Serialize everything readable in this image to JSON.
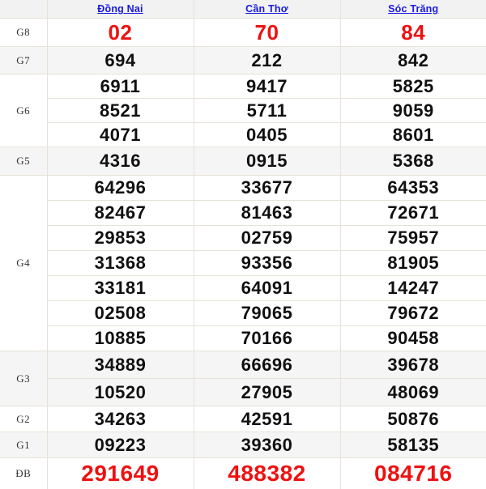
{
  "table": {
    "header": {
      "label_blank": "",
      "provinces": [
        {
          "name": "Đồng Nai"
        },
        {
          "name": "Cần Thơ"
        },
        {
          "name": "Sóc Trăng"
        }
      ]
    },
    "link_color": "#1a1ae0",
    "highlight_color": "#ee1111",
    "text_color": "#101010",
    "row_shade_color": "#f5f5f5",
    "border_color": "#e6e2d8",
    "prizes": [
      {
        "label": "G8",
        "style": "red",
        "rows": [
          {
            "values": [
              "02",
              "70",
              "84"
            ]
          }
        ]
      },
      {
        "label": "G7",
        "style": "normal",
        "rows": [
          {
            "values": [
              "694",
              "212",
              "842"
            ]
          }
        ]
      },
      {
        "label": "G6",
        "style": "normal",
        "rows": [
          {
            "values": [
              "6911",
              "9417",
              "5825"
            ]
          },
          {
            "values": [
              "8521",
              "5711",
              "9059"
            ]
          },
          {
            "values": [
              "4071",
              "0405",
              "8601"
            ]
          }
        ]
      },
      {
        "label": "G5",
        "style": "normal",
        "rows": [
          {
            "values": [
              "4316",
              "0915",
              "5368"
            ]
          }
        ]
      },
      {
        "label": "G4",
        "style": "normal",
        "rows": [
          {
            "values": [
              "64296",
              "33677",
              "64353"
            ]
          },
          {
            "values": [
              "82467",
              "81463",
              "72671"
            ]
          },
          {
            "values": [
              "29853",
              "02759",
              "75957"
            ]
          },
          {
            "values": [
              "31368",
              "93356",
              "81905"
            ]
          },
          {
            "values": [
              "33181",
              "64091",
              "14247"
            ]
          },
          {
            "values": [
              "02508",
              "79065",
              "79672"
            ]
          },
          {
            "values": [
              "10885",
              "70166",
              "90458"
            ]
          }
        ]
      },
      {
        "label": "G3",
        "style": "normal",
        "rows": [
          {
            "values": [
              "34889",
              "66696",
              "39678"
            ]
          },
          {
            "values": [
              "10520",
              "27905",
              "48069"
            ]
          }
        ]
      },
      {
        "label": "G2",
        "style": "normal",
        "rows": [
          {
            "values": [
              "34263",
              "42591",
              "50876"
            ]
          }
        ]
      },
      {
        "label": "G1",
        "style": "normal",
        "rows": [
          {
            "values": [
              "09223",
              "39360",
              "58135"
            ]
          }
        ]
      },
      {
        "label": "ĐB",
        "style": "red-big",
        "rows": [
          {
            "values": [
              "291649",
              "488382",
              "084716"
            ]
          }
        ]
      }
    ]
  }
}
